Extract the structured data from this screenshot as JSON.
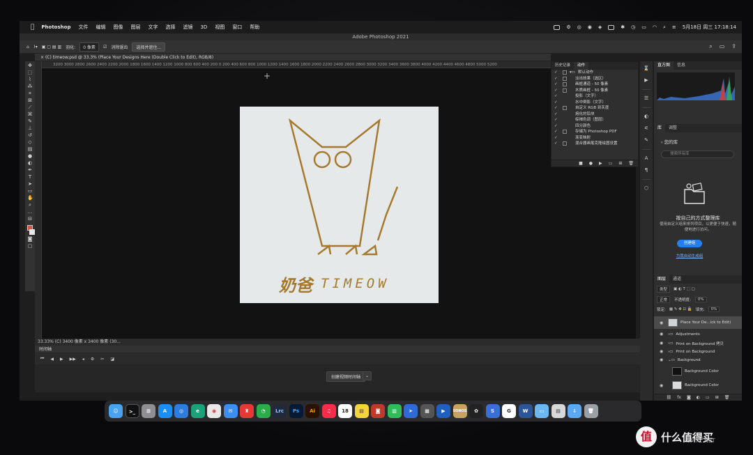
{
  "menubar": {
    "apple": "",
    "items": [
      "Photoshop",
      "文件",
      "编辑",
      "图像",
      "图层",
      "文字",
      "选择",
      "滤镜",
      "3D",
      "视图",
      "窗口",
      "帮助"
    ],
    "clock": "5月18日 周三  17:18:14"
  },
  "app_title": "Adobe Photoshop 2021",
  "options": {
    "feather_label": "羽化:",
    "feather_value": "0 像素",
    "antialias_label": "消除锯齿",
    "select_mask_button": "选择并遮住..."
  },
  "document": {
    "tab_title": "(C) timeow.psd @ 33.3% (Place Your Designs Here (Double Click to Edit), RGB/8)",
    "ruler_h": "3200 3000 2800 2600 2400 2200 2000 1800 1600 1400 1200 1000  800  600  400  200   0   200  400  600  800  1000 1200 1400 1600 1800 2000 2200 2400 2600 2800 3000 3200 3400 3600 3800 4000 4200 4400 4600 4800 5000 5200",
    "status": "33.33%     (C) 3400 像素 x 3400 像素 (30..."
  },
  "artwork": {
    "brand_cn": "奶爸",
    "brand_en": "TIMEOW",
    "gold": "#a57a2e",
    "bg": "#e5e9ea"
  },
  "actions_panel": {
    "tabs": [
      "历史记录",
      "动作"
    ],
    "set_name": "默认动作",
    "items": [
      "淡出效果（选区）",
      "画框通道 - 50 像素",
      "木质画框 - 50 像素",
      "投影（文字）",
      "水中倒影（文字）",
      "自定义 RGB 到灰度",
      "熔化的铅块",
      "棕褐色调（图层）",
      "四分颜色",
      "存储为 Photoshop PDF",
      "渐变映射",
      "混合器画笔克隆绘图设置"
    ]
  },
  "timeline": {
    "title": "时间轴",
    "create_button": "创建视频时间轴"
  },
  "right_panels": {
    "top_tabs": [
      "直方图",
      "信息"
    ],
    "lib_tabs": [
      "库",
      "调整"
    ],
    "lib_title": "您的库",
    "lib_search_placeholder": "搜索所有库",
    "lib_heading": "按自己的方式整理库",
    "lib_desc": "使用自定义组来排列项目，以更便于快速，随便地进行访问。",
    "lib_button": "创建组",
    "lib_link": "为我自动生成组",
    "layer_tabs": [
      "图层",
      "通道"
    ],
    "filter_label": "类型",
    "blend_mode": "正常",
    "opacity_label": "不透明度:",
    "opacity_value": "0%",
    "lock_label": "锁定:",
    "fill_label": "填充:",
    "fill_value": "0%",
    "layers": [
      "Place Your De...ick to Edit)",
      "Adjustments",
      "Print on Background 拷贝",
      "Print on Background",
      "Background",
      "Background Color",
      "Background Color"
    ]
  },
  "dock_apps": [
    "Finder",
    "Terminal",
    "Launchpad",
    "App Store",
    "Safari",
    "Edge",
    "Chrome",
    "Mail",
    "Stamp",
    "WeChat",
    "Lrc",
    "Ps",
    "Ai",
    "Music",
    "18",
    "Notes",
    "Photo Booth",
    "Numbers",
    "Pigeon",
    "Calculator",
    "Prime",
    "SONOS",
    "ChatGPT",
    "Bear",
    "G",
    "W",
    "Preview",
    "Doc",
    "Files",
    "Trash"
  ],
  "calendar_day": "18",
  "watermark": {
    "badge": "值",
    "text": "什么值得买",
    "sub": "SMYZ.NET"
  }
}
